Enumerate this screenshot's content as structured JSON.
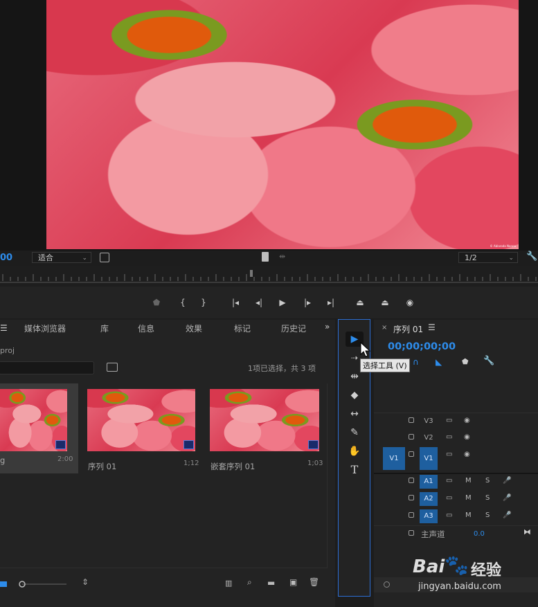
{
  "monitor": {
    "timecode": "00",
    "fit_select": "适合",
    "resolution_select": "1/2",
    "watermark": "© Ablaroda Nanna"
  },
  "project": {
    "tabs": [
      "媒体浏览器",
      "库",
      "信息",
      "效果",
      "标记",
      "历史记"
    ],
    "file_name": "proj",
    "search_value": "",
    "selection_status": "1项已选择，共 3 项",
    "items": [
      {
        "label": "g",
        "duration": "2:00",
        "selected": true
      },
      {
        "label": "序列 01",
        "duration": "1;12",
        "selected": false
      },
      {
        "label": "嵌套序列 01",
        "duration": "1;03",
        "selected": false
      }
    ]
  },
  "tools": {
    "tooltip": "选择工具 (V)"
  },
  "timeline": {
    "sequence_title": "序列 01",
    "timecode": "00;00;00;00",
    "video_tracks": [
      "V3",
      "V2",
      "V1"
    ],
    "video_source": "V1",
    "audio_tracks": [
      "A1",
      "A2",
      "A3"
    ],
    "audio_m": "M",
    "audio_s": "S",
    "master_label": "主声道",
    "master_value": "0.0"
  },
  "overlay": {
    "baidu_brand": "Bai",
    "baidu_cn": "经验",
    "baidu_url": "jingyan.baidu.com"
  },
  "colors": {
    "accent": "#2d8ceb",
    "track_active": "#1e5f9f",
    "panel_focus": "#2d6fd6"
  }
}
